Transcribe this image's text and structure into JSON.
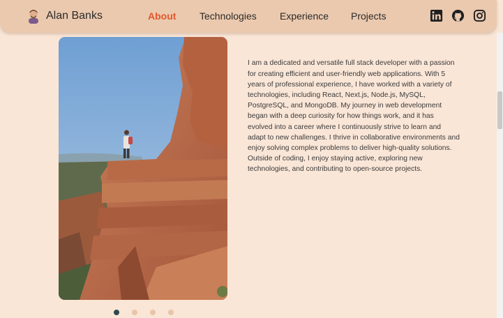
{
  "header": {
    "name": "Alan Banks",
    "nav": [
      "About",
      "Technologies",
      "Experience",
      "Projects"
    ],
    "active_nav": "About",
    "social": [
      "linkedin-icon",
      "github-icon",
      "instagram-icon"
    ]
  },
  "about": {
    "bio": "I am a dedicated and versatile full stack developer with a passion for creating efficient and user-friendly web applications. With 5 years of professional experience, I have worked with a variety of technologies, including React, Next.js, Node.js, MySQL, PostgreSQL, and MongoDB. My journey in web development began with a deep curiosity for how things work, and it has evolved into a career where I continuously strive to learn and adapt to new challenges. I thrive in collaborative environments and enjoy solving complex problems to deliver high-quality solutions. Outside of coding, I enjoy staying active, exploring new technologies, and contributing to open-source projects."
  },
  "carousel": {
    "slides": 4,
    "active_index": 0
  },
  "colors": {
    "background": "#fae6d7",
    "header": "#ebc9ae",
    "accent": "#e2572c",
    "dot_active": "#2c4b4d",
    "dot_inactive": "#e9c5a6"
  }
}
